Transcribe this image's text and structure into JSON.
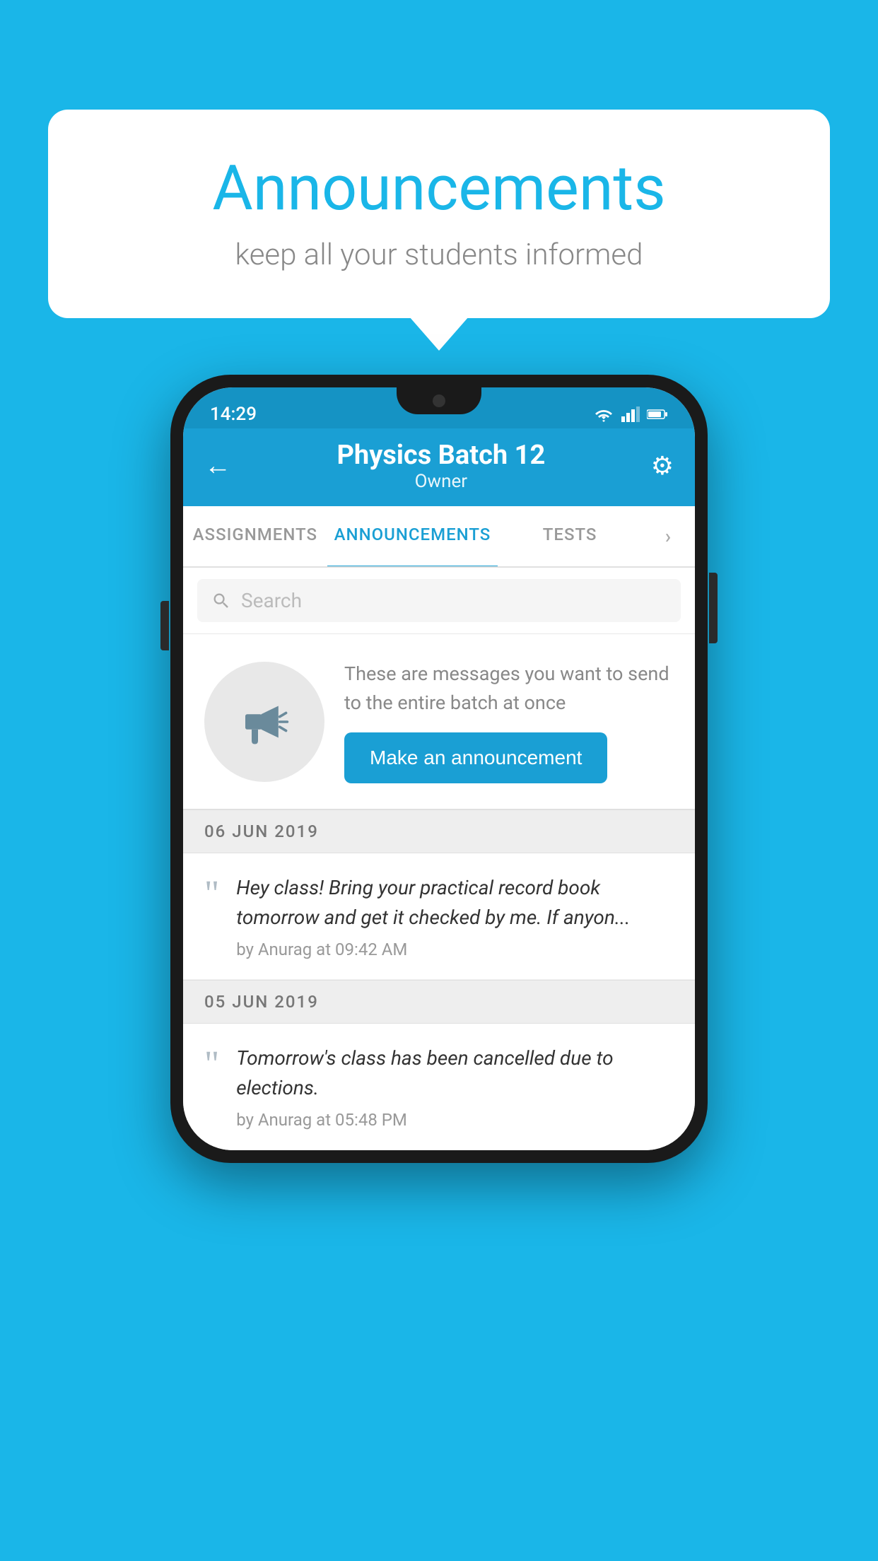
{
  "background_color": "#1ab6e8",
  "speech_bubble": {
    "title": "Announcements",
    "subtitle": "keep all your students informed"
  },
  "status_bar": {
    "time": "14:29",
    "wifi_icon": "wifi-icon",
    "signal_icon": "signal-icon",
    "battery_icon": "battery-icon"
  },
  "header": {
    "back_label": "←",
    "title": "Physics Batch 12",
    "subtitle": "Owner",
    "gear_label": "⚙"
  },
  "tabs": [
    {
      "label": "ASSIGNMENTS",
      "active": false
    },
    {
      "label": "ANNOUNCEMENTS",
      "active": true
    },
    {
      "label": "TESTS",
      "active": false
    },
    {
      "label": "•",
      "active": false
    }
  ],
  "search": {
    "placeholder": "Search"
  },
  "promo": {
    "description": "These are messages you want to send to the entire batch at once",
    "button_label": "Make an announcement"
  },
  "announcements": [
    {
      "date": "06  JUN  2019",
      "text": "Hey class! Bring your practical record book tomorrow and get it checked by me. If anyon...",
      "meta": "by Anurag at 09:42 AM"
    },
    {
      "date": "05  JUN  2019",
      "text": "Tomorrow's class has been cancelled due to elections.",
      "meta": "by Anurag at 05:48 PM"
    }
  ]
}
